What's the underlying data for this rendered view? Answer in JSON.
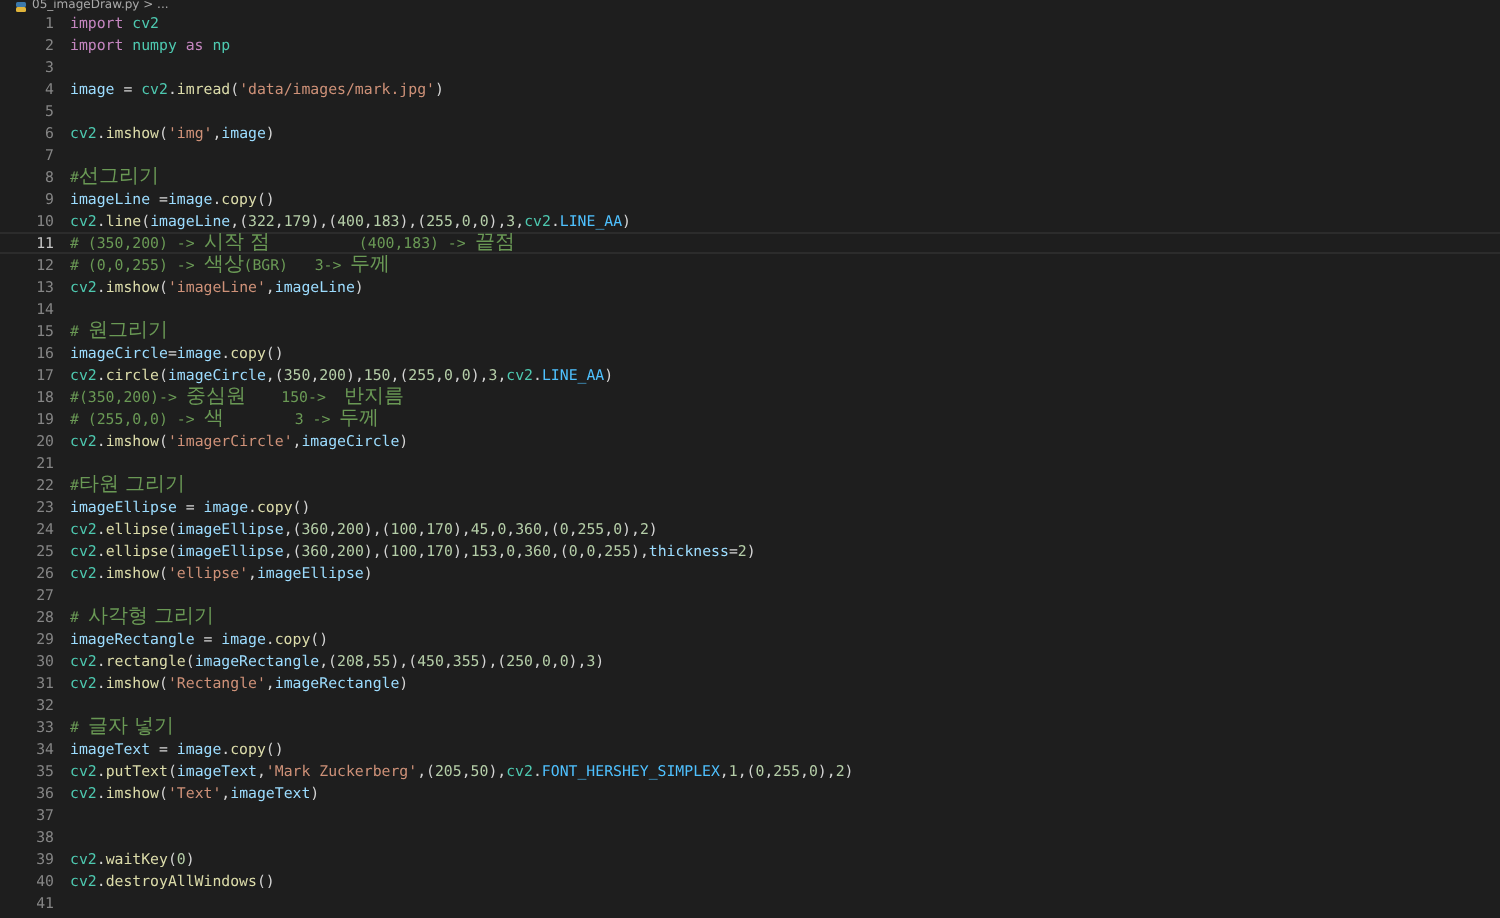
{
  "breadcrumb": "05_imageDraw.py > ...",
  "lines": [
    {
      "number": "1",
      "selected": false,
      "tokens": [
        {
          "kind": "kw",
          "text": "import"
        },
        {
          "kind": "mod",
          "text": " cv2"
        }
      ]
    },
    {
      "number": "2",
      "selected": false,
      "tokens": [
        {
          "kind": "kw",
          "text": "import"
        },
        {
          "kind": "mod",
          "text": " numpy"
        },
        {
          "kind": "kw",
          "text": " as"
        },
        {
          "kind": "mod",
          "text": " np"
        }
      ]
    },
    {
      "number": "3",
      "selected": false
    },
    {
      "number": "4",
      "selected": false,
      "tokens": [
        {
          "kind": "var",
          "text": "image"
        },
        {
          "kind": "p",
          "text": " = "
        },
        {
          "kind": "mod",
          "text": "cv2"
        },
        {
          "kind": "p",
          "text": "."
        },
        {
          "kind": "fn",
          "text": "imread"
        },
        {
          "kind": "p",
          "text": "("
        },
        {
          "kind": "str",
          "text": "'data/images/mark.jpg'"
        },
        {
          "kind": "p",
          "text": ")"
        }
      ]
    },
    {
      "number": "5",
      "selected": false
    },
    {
      "number": "6",
      "selected": false,
      "tokens": [
        {
          "kind": "mod",
          "text": "cv2"
        },
        {
          "kind": "p",
          "text": "."
        },
        {
          "kind": "fn",
          "text": "imshow"
        },
        {
          "kind": "p",
          "text": "("
        },
        {
          "kind": "str",
          "text": "'img'"
        },
        {
          "kind": "p",
          "text": ","
        },
        {
          "kind": "var",
          "text": "image"
        },
        {
          "kind": "p",
          "text": ")"
        }
      ]
    },
    {
      "number": "7",
      "selected": false
    },
    {
      "number": "8",
      "selected": false,
      "tokens": [
        {
          "kind": "cmt",
          "text": "#"
        },
        {
          "kind": "ko",
          "text": "선그리기"
        }
      ]
    },
    {
      "number": "9",
      "selected": false,
      "tokens": [
        {
          "kind": "var",
          "text": "imageLine"
        },
        {
          "kind": "p",
          "text": " ="
        },
        {
          "kind": "var",
          "text": "image"
        },
        {
          "kind": "p",
          "text": "."
        },
        {
          "kind": "fn",
          "text": "copy"
        },
        {
          "kind": "p",
          "text": "()"
        }
      ]
    },
    {
      "number": "10",
      "selected": false,
      "tokens": [
        {
          "kind": "mod",
          "text": "cv2"
        },
        {
          "kind": "p",
          "text": "."
        },
        {
          "kind": "fn",
          "text": "line"
        },
        {
          "kind": "p",
          "text": "("
        },
        {
          "kind": "var",
          "text": "imageLine"
        },
        {
          "kind": "p",
          "text": ",("
        },
        {
          "kind": "num",
          "text": "322"
        },
        {
          "kind": "p",
          "text": ","
        },
        {
          "kind": "num",
          "text": "179"
        },
        {
          "kind": "p",
          "text": "),("
        },
        {
          "kind": "num",
          "text": "400"
        },
        {
          "kind": "p",
          "text": ","
        },
        {
          "kind": "num",
          "text": "183"
        },
        {
          "kind": "p",
          "text": "),("
        },
        {
          "kind": "num",
          "text": "255"
        },
        {
          "kind": "p",
          "text": ","
        },
        {
          "kind": "num",
          "text": "0"
        },
        {
          "kind": "p",
          "text": ","
        },
        {
          "kind": "num",
          "text": "0"
        },
        {
          "kind": "p",
          "text": "),"
        },
        {
          "kind": "num",
          "text": "3"
        },
        {
          "kind": "p",
          "text": ","
        },
        {
          "kind": "mod",
          "text": "cv2"
        },
        {
          "kind": "p",
          "text": "."
        },
        {
          "kind": "const",
          "text": "LINE_AA"
        },
        {
          "kind": "p",
          "text": ")"
        }
      ]
    },
    {
      "number": "11",
      "selected": true,
      "tokens": [
        {
          "kind": "cmt",
          "text": "# (350,200) -> "
        },
        {
          "kind": "ko",
          "text": "시작 점"
        },
        {
          "kind": "cmt",
          "text": "          (400,183) -> "
        },
        {
          "kind": "ko",
          "text": "끝점"
        }
      ]
    },
    {
      "number": "12",
      "selected": false,
      "tokens": [
        {
          "kind": "cmt",
          "text": "# (0,0,255) -> "
        },
        {
          "kind": "ko",
          "text": "색상"
        },
        {
          "kind": "cmt",
          "text": "(BGR)   3-> "
        },
        {
          "kind": "ko",
          "text": "두께"
        }
      ]
    },
    {
      "number": "13",
      "selected": false,
      "tokens": [
        {
          "kind": "mod",
          "text": "cv2"
        },
        {
          "kind": "p",
          "text": "."
        },
        {
          "kind": "fn",
          "text": "imshow"
        },
        {
          "kind": "p",
          "text": "("
        },
        {
          "kind": "str",
          "text": "'imageLine'"
        },
        {
          "kind": "p",
          "text": ","
        },
        {
          "kind": "var",
          "text": "imageLine"
        },
        {
          "kind": "p",
          "text": ")"
        }
      ]
    },
    {
      "number": "14",
      "selected": false
    },
    {
      "number": "15",
      "selected": false,
      "tokens": [
        {
          "kind": "cmt",
          "text": "# "
        },
        {
          "kind": "ko",
          "text": "원그리기"
        }
      ]
    },
    {
      "number": "16",
      "selected": false,
      "tokens": [
        {
          "kind": "var",
          "text": "imageCircle"
        },
        {
          "kind": "p",
          "text": "="
        },
        {
          "kind": "var",
          "text": "image"
        },
        {
          "kind": "p",
          "text": "."
        },
        {
          "kind": "fn",
          "text": "copy"
        },
        {
          "kind": "p",
          "text": "()"
        }
      ]
    },
    {
      "number": "17",
      "selected": false,
      "tokens": [
        {
          "kind": "mod",
          "text": "cv2"
        },
        {
          "kind": "p",
          "text": "."
        },
        {
          "kind": "fn",
          "text": "circle"
        },
        {
          "kind": "p",
          "text": "("
        },
        {
          "kind": "var",
          "text": "imageCircle"
        },
        {
          "kind": "p",
          "text": ",("
        },
        {
          "kind": "num",
          "text": "350"
        },
        {
          "kind": "p",
          "text": ","
        },
        {
          "kind": "num",
          "text": "200"
        },
        {
          "kind": "p",
          "text": "),"
        },
        {
          "kind": "num",
          "text": "150"
        },
        {
          "kind": "p",
          "text": ",("
        },
        {
          "kind": "num",
          "text": "255"
        },
        {
          "kind": "p",
          "text": ","
        },
        {
          "kind": "num",
          "text": "0"
        },
        {
          "kind": "p",
          "text": ","
        },
        {
          "kind": "num",
          "text": "0"
        },
        {
          "kind": "p",
          "text": "),"
        },
        {
          "kind": "num",
          "text": "3"
        },
        {
          "kind": "p",
          "text": ","
        },
        {
          "kind": "mod",
          "text": "cv2"
        },
        {
          "kind": "p",
          "text": "."
        },
        {
          "kind": "const",
          "text": "LINE_AA"
        },
        {
          "kind": "p",
          "text": ")"
        }
      ]
    },
    {
      "number": "18",
      "selected": false,
      "tokens": [
        {
          "kind": "cmt",
          "text": "#(350,200)-> "
        },
        {
          "kind": "ko",
          "text": "중심원"
        },
        {
          "kind": "cmt",
          "text": "    150->  "
        },
        {
          "kind": "ko",
          "text": "반지름"
        }
      ]
    },
    {
      "number": "19",
      "selected": false,
      "tokens": [
        {
          "kind": "cmt",
          "text": "# (255,0,0) -> "
        },
        {
          "kind": "ko",
          "text": "색"
        },
        {
          "kind": "cmt",
          "text": "        3 -> "
        },
        {
          "kind": "ko",
          "text": "두께"
        }
      ]
    },
    {
      "number": "20",
      "selected": false,
      "tokens": [
        {
          "kind": "mod",
          "text": "cv2"
        },
        {
          "kind": "p",
          "text": "."
        },
        {
          "kind": "fn",
          "text": "imshow"
        },
        {
          "kind": "p",
          "text": "("
        },
        {
          "kind": "str",
          "text": "'imagerCircle'"
        },
        {
          "kind": "p",
          "text": ","
        },
        {
          "kind": "var",
          "text": "imageCircle"
        },
        {
          "kind": "p",
          "text": ")"
        }
      ]
    },
    {
      "number": "21",
      "selected": false
    },
    {
      "number": "22",
      "selected": false,
      "tokens": [
        {
          "kind": "cmt",
          "text": "#"
        },
        {
          "kind": "ko",
          "text": "타원 그리기"
        }
      ]
    },
    {
      "number": "23",
      "selected": false,
      "tokens": [
        {
          "kind": "var",
          "text": "imageEllipse"
        },
        {
          "kind": "p",
          "text": " = "
        },
        {
          "kind": "var",
          "text": "image"
        },
        {
          "kind": "p",
          "text": "."
        },
        {
          "kind": "fn",
          "text": "copy"
        },
        {
          "kind": "p",
          "text": "()"
        }
      ]
    },
    {
      "number": "24",
      "selected": false,
      "tokens": [
        {
          "kind": "mod",
          "text": "cv2"
        },
        {
          "kind": "p",
          "text": "."
        },
        {
          "kind": "fn",
          "text": "ellipse"
        },
        {
          "kind": "p",
          "text": "("
        },
        {
          "kind": "var",
          "text": "imageEllipse"
        },
        {
          "kind": "p",
          "text": ",("
        },
        {
          "kind": "num",
          "text": "360"
        },
        {
          "kind": "p",
          "text": ","
        },
        {
          "kind": "num",
          "text": "200"
        },
        {
          "kind": "p",
          "text": "),("
        },
        {
          "kind": "num",
          "text": "100"
        },
        {
          "kind": "p",
          "text": ","
        },
        {
          "kind": "num",
          "text": "170"
        },
        {
          "kind": "p",
          "text": "),"
        },
        {
          "kind": "num",
          "text": "45"
        },
        {
          "kind": "p",
          "text": ","
        },
        {
          "kind": "num",
          "text": "0"
        },
        {
          "kind": "p",
          "text": ","
        },
        {
          "kind": "num",
          "text": "360"
        },
        {
          "kind": "p",
          "text": ",("
        },
        {
          "kind": "num",
          "text": "0"
        },
        {
          "kind": "p",
          "text": ","
        },
        {
          "kind": "num",
          "text": "255"
        },
        {
          "kind": "p",
          "text": ","
        },
        {
          "kind": "num",
          "text": "0"
        },
        {
          "kind": "p",
          "text": "),"
        },
        {
          "kind": "num",
          "text": "2"
        },
        {
          "kind": "p",
          "text": ")"
        }
      ]
    },
    {
      "number": "25",
      "selected": false,
      "tokens": [
        {
          "kind": "mod",
          "text": "cv2"
        },
        {
          "kind": "p",
          "text": "."
        },
        {
          "kind": "fn",
          "text": "ellipse"
        },
        {
          "kind": "p",
          "text": "("
        },
        {
          "kind": "var",
          "text": "imageEllipse"
        },
        {
          "kind": "p",
          "text": ",("
        },
        {
          "kind": "num",
          "text": "360"
        },
        {
          "kind": "p",
          "text": ","
        },
        {
          "kind": "num",
          "text": "200"
        },
        {
          "kind": "p",
          "text": "),("
        },
        {
          "kind": "num",
          "text": "100"
        },
        {
          "kind": "p",
          "text": ","
        },
        {
          "kind": "num",
          "text": "170"
        },
        {
          "kind": "p",
          "text": "),"
        },
        {
          "kind": "num",
          "text": "153"
        },
        {
          "kind": "p",
          "text": ","
        },
        {
          "kind": "num",
          "text": "0"
        },
        {
          "kind": "p",
          "text": ","
        },
        {
          "kind": "num",
          "text": "360"
        },
        {
          "kind": "p",
          "text": ",("
        },
        {
          "kind": "num",
          "text": "0"
        },
        {
          "kind": "p",
          "text": ","
        },
        {
          "kind": "num",
          "text": "0"
        },
        {
          "kind": "p",
          "text": ","
        },
        {
          "kind": "num",
          "text": "255"
        },
        {
          "kind": "p",
          "text": "),"
        },
        {
          "kind": "var",
          "text": "thickness"
        },
        {
          "kind": "p",
          "text": "="
        },
        {
          "kind": "num",
          "text": "2"
        },
        {
          "kind": "p",
          "text": ")"
        }
      ]
    },
    {
      "number": "26",
      "selected": false,
      "tokens": [
        {
          "kind": "mod",
          "text": "cv2"
        },
        {
          "kind": "p",
          "text": "."
        },
        {
          "kind": "fn",
          "text": "imshow"
        },
        {
          "kind": "p",
          "text": "("
        },
        {
          "kind": "str",
          "text": "'ellipse'"
        },
        {
          "kind": "p",
          "text": ","
        },
        {
          "kind": "var",
          "text": "imageEllipse"
        },
        {
          "kind": "p",
          "text": ")"
        }
      ]
    },
    {
      "number": "27",
      "selected": false
    },
    {
      "number": "28",
      "selected": false,
      "tokens": [
        {
          "kind": "cmt",
          "text": "# "
        },
        {
          "kind": "ko",
          "text": "사각형 그리기"
        }
      ]
    },
    {
      "number": "29",
      "selected": false,
      "tokens": [
        {
          "kind": "var",
          "text": "imageRectangle"
        },
        {
          "kind": "p",
          "text": " = "
        },
        {
          "kind": "var",
          "text": "image"
        },
        {
          "kind": "p",
          "text": "."
        },
        {
          "kind": "fn",
          "text": "copy"
        },
        {
          "kind": "p",
          "text": "()"
        }
      ]
    },
    {
      "number": "30",
      "selected": false,
      "tokens": [
        {
          "kind": "mod",
          "text": "cv2"
        },
        {
          "kind": "p",
          "text": "."
        },
        {
          "kind": "fn",
          "text": "rectangle"
        },
        {
          "kind": "p",
          "text": "("
        },
        {
          "kind": "var",
          "text": "imageRectangle"
        },
        {
          "kind": "p",
          "text": ",("
        },
        {
          "kind": "num",
          "text": "208"
        },
        {
          "kind": "p",
          "text": ","
        },
        {
          "kind": "num",
          "text": "55"
        },
        {
          "kind": "p",
          "text": "),("
        },
        {
          "kind": "num",
          "text": "450"
        },
        {
          "kind": "p",
          "text": ","
        },
        {
          "kind": "num",
          "text": "355"
        },
        {
          "kind": "p",
          "text": "),("
        },
        {
          "kind": "num",
          "text": "250"
        },
        {
          "kind": "p",
          "text": ","
        },
        {
          "kind": "num",
          "text": "0"
        },
        {
          "kind": "p",
          "text": ","
        },
        {
          "kind": "num",
          "text": "0"
        },
        {
          "kind": "p",
          "text": "),"
        },
        {
          "kind": "num",
          "text": "3"
        },
        {
          "kind": "p",
          "text": ")"
        }
      ]
    },
    {
      "number": "31",
      "selected": false,
      "tokens": [
        {
          "kind": "mod",
          "text": "cv2"
        },
        {
          "kind": "p",
          "text": "."
        },
        {
          "kind": "fn",
          "text": "imshow"
        },
        {
          "kind": "p",
          "text": "("
        },
        {
          "kind": "str",
          "text": "'Rectangle'"
        },
        {
          "kind": "p",
          "text": ","
        },
        {
          "kind": "var",
          "text": "imageRectangle"
        },
        {
          "kind": "p",
          "text": ")"
        }
      ]
    },
    {
      "number": "32",
      "selected": false
    },
    {
      "number": "33",
      "selected": false,
      "tokens": [
        {
          "kind": "cmt",
          "text": "# "
        },
        {
          "kind": "ko",
          "text": "글자 넣기"
        }
      ]
    },
    {
      "number": "34",
      "selected": false,
      "tokens": [
        {
          "kind": "var",
          "text": "imageText"
        },
        {
          "kind": "p",
          "text": " = "
        },
        {
          "kind": "var",
          "text": "image"
        },
        {
          "kind": "p",
          "text": "."
        },
        {
          "kind": "fn",
          "text": "copy"
        },
        {
          "kind": "p",
          "text": "()"
        }
      ]
    },
    {
      "number": "35",
      "selected": false,
      "tokens": [
        {
          "kind": "mod",
          "text": "cv2"
        },
        {
          "kind": "p",
          "text": "."
        },
        {
          "kind": "fn",
          "text": "putText"
        },
        {
          "kind": "p",
          "text": "("
        },
        {
          "kind": "var",
          "text": "imageText"
        },
        {
          "kind": "p",
          "text": ","
        },
        {
          "kind": "str",
          "text": "'Mark Zuckerberg'"
        },
        {
          "kind": "p",
          "text": ",("
        },
        {
          "kind": "num",
          "text": "205"
        },
        {
          "kind": "p",
          "text": ","
        },
        {
          "kind": "num",
          "text": "50"
        },
        {
          "kind": "p",
          "text": "),"
        },
        {
          "kind": "mod",
          "text": "cv2"
        },
        {
          "kind": "p",
          "text": "."
        },
        {
          "kind": "const",
          "text": "FONT_HERSHEY_SIMPLEX"
        },
        {
          "kind": "p",
          "text": ","
        },
        {
          "kind": "num",
          "text": "1"
        },
        {
          "kind": "p",
          "text": ",("
        },
        {
          "kind": "num",
          "text": "0"
        },
        {
          "kind": "p",
          "text": ","
        },
        {
          "kind": "num",
          "text": "255"
        },
        {
          "kind": "p",
          "text": ","
        },
        {
          "kind": "num",
          "text": "0"
        },
        {
          "kind": "p",
          "text": "),"
        },
        {
          "kind": "num",
          "text": "2"
        },
        {
          "kind": "p",
          "text": ")"
        }
      ]
    },
    {
      "number": "36",
      "selected": false,
      "tokens": [
        {
          "kind": "mod",
          "text": "cv2"
        },
        {
          "kind": "p",
          "text": "."
        },
        {
          "kind": "fn",
          "text": "imshow"
        },
        {
          "kind": "p",
          "text": "("
        },
        {
          "kind": "str",
          "text": "'Text'"
        },
        {
          "kind": "p",
          "text": ","
        },
        {
          "kind": "var",
          "text": "imageText"
        },
        {
          "kind": "p",
          "text": ")"
        }
      ]
    },
    {
      "number": "37",
      "selected": false
    },
    {
      "number": "38",
      "selected": false
    },
    {
      "number": "39",
      "selected": false,
      "tokens": [
        {
          "kind": "mod",
          "text": "cv2"
        },
        {
          "kind": "p",
          "text": "."
        },
        {
          "kind": "fn",
          "text": "waitKey"
        },
        {
          "kind": "p",
          "text": "("
        },
        {
          "kind": "num",
          "text": "0"
        },
        {
          "kind": "p",
          "text": ")"
        }
      ]
    },
    {
      "number": "40",
      "selected": false,
      "tokens": [
        {
          "kind": "mod",
          "text": "cv2"
        },
        {
          "kind": "p",
          "text": "."
        },
        {
          "kind": "fn",
          "text": "destroyAllWindows"
        },
        {
          "kind": "p",
          "text": "()"
        }
      ]
    },
    {
      "number": "41",
      "selected": false
    }
  ]
}
